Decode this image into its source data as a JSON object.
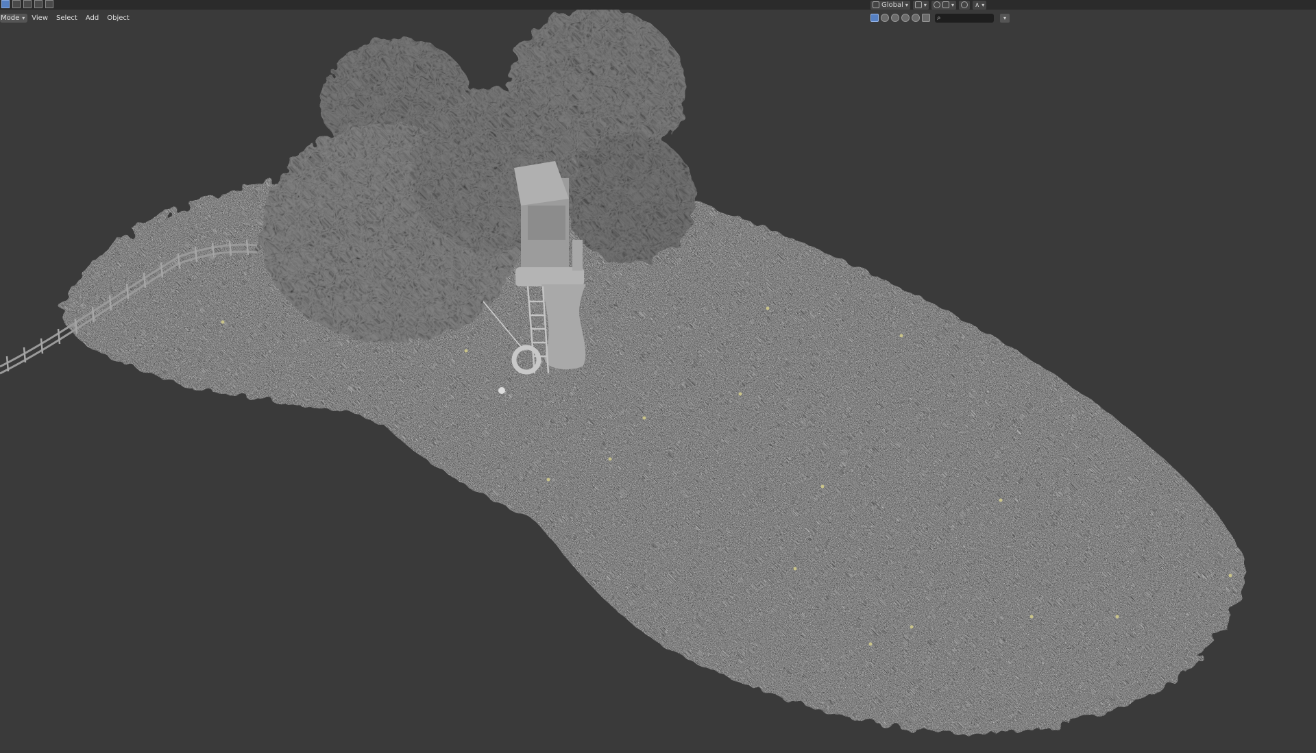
{
  "header": {
    "mode_label": "Mode",
    "menus": [
      "View",
      "Select",
      "Add",
      "Object"
    ]
  },
  "toolbar": {
    "transform_orientation": "Global"
  },
  "icons": {
    "mode_dropdown": "chevron-down-icon",
    "orientation": "transform-orientation-icon",
    "pivot": "pivot-point-icon",
    "snap": "snap-icon",
    "proportional": "proportional-edit-icon",
    "search": "search-icon",
    "filter": "filter-icon"
  },
  "colors": {
    "viewport_bg": "#3a3a3a",
    "header_bg": "#2b2b2b",
    "active_blue": "#5680c2",
    "grass": "#4a4a4a",
    "foliage": "#7a7a7a",
    "trunk": "#a8a8a8"
  }
}
